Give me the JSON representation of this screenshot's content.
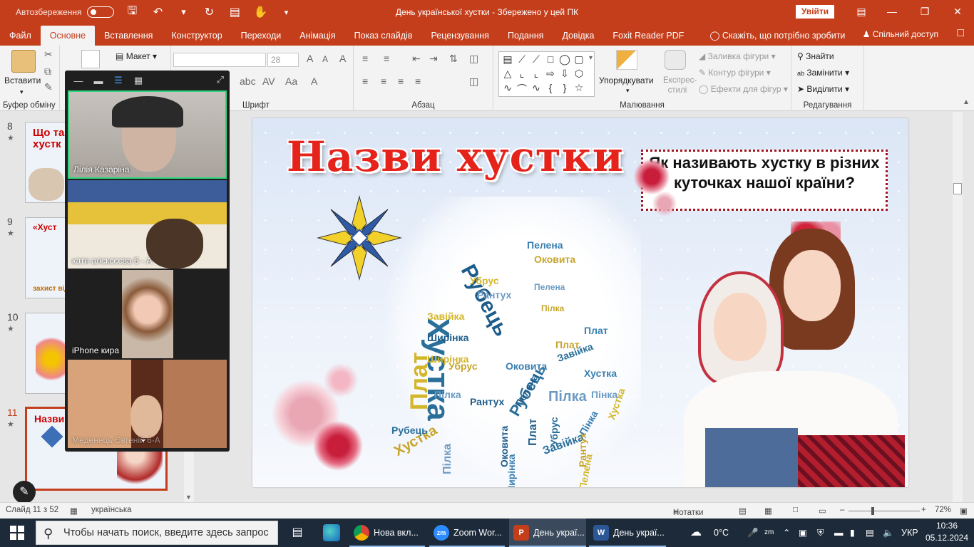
{
  "titlebar": {
    "autosave_label": "Автозбереження",
    "doc_title": "День української хустки  -  Збережено у цей ПК",
    "signin_label": "Увійти"
  },
  "tabs": [
    "Файл",
    "Основне",
    "Вставлення",
    "Конструктор",
    "Переходи",
    "Анімація",
    "Показ слайдів",
    "Рецензування",
    "Подання",
    "Довідка",
    "Foxit Reader PDF"
  ],
  "tellme": "Скажіть, що потрібно зробити",
  "share": "Спільний доступ",
  "ribbon": {
    "paste": "Вставити",
    "clipboard": "Буфер обміну",
    "layout": "Макет",
    "font_group": "Шрифт",
    "font_size": "28",
    "paragraph": "Абзац",
    "arrange": "Упорядкувати",
    "styles": "Експрес-стилі",
    "shape_fill": "Заливка фігури",
    "shape_outline": "Контур фігури",
    "shape_effects": "Ефекти для фігур",
    "drawing": "Малювання",
    "find": "Знайти",
    "replace": "Замінити",
    "select": "Виділити",
    "editing": "Редагування"
  },
  "thumbs": [
    {
      "num": "8",
      "title": "Що так",
      "sub": "хустк"
    },
    {
      "num": "9",
      "title": "«Хуст",
      "sub": "захист від"
    },
    {
      "num": "10",
      "title": "",
      "sub": ""
    },
    {
      "num": "11",
      "title": "Назви",
      "sub": ""
    }
  ],
  "slide": {
    "title": "Назви хустки",
    "question": "Як називають хустку в різних куточках нашої країни?",
    "words": [
      "Хустка",
      "Рубець",
      "Плат",
      "Пілка",
      "Пелена",
      "Оковита",
      "Завійка",
      "Ширінка",
      "Убрус",
      "Рантух",
      "Пінка",
      "Хустка",
      "Рубець",
      "Плат",
      "Пелена",
      "Пілка",
      "Оковита",
      "Убрус",
      "Завійка",
      "Рантух",
      "Ширінка",
      "Пінка",
      "Хустка",
      "Плат",
      "Рубець",
      "Пелена",
      "Завійка",
      "Пілка",
      "Ширінка",
      "Рантух",
      "Убрус",
      "Оковита",
      "Хустка",
      "Пелена",
      "Плат",
      "Пілка"
    ]
  },
  "zoom": {
    "participants": [
      {
        "name": "Лілія Казаріна"
      },
      {
        "name": "катя алєксєєва 6 - А"
      },
      {
        "name": "iPhone кира"
      },
      {
        "name": "Меденець Євгеній 6-А"
      }
    ]
  },
  "status": {
    "slide_info": "Слайд 11 з 52",
    "language": "українська",
    "notes": "Нотатки",
    "zoom": "72%"
  },
  "taskbar": {
    "search_placeholder": "Чтобы начать поиск, введите здесь запрос",
    "apps": [
      "Нова вкл...",
      "Zoom Wor...",
      "День украї...",
      "День украї..."
    ],
    "weather": "0°C",
    "lang": "УКР",
    "time": "10:36",
    "date": "05.12.2024"
  },
  "colors": {
    "accent": "#c43e1c",
    "title_red": "#e5231b",
    "zoom_active": "#2dd67b"
  }
}
